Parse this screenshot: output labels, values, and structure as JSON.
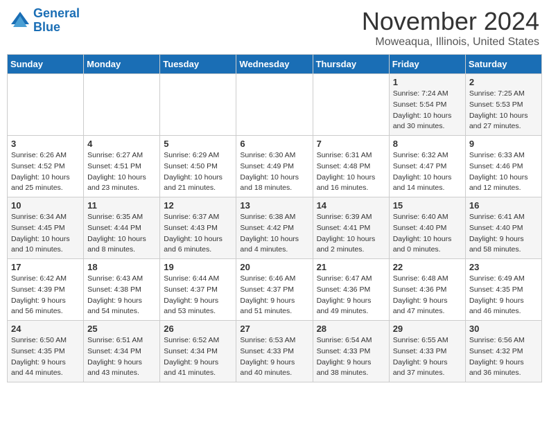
{
  "header": {
    "logo_line1": "General",
    "logo_line2": "Blue",
    "month": "November 2024",
    "location": "Moweaqua, Illinois, United States"
  },
  "days_of_week": [
    "Sunday",
    "Monday",
    "Tuesday",
    "Wednesday",
    "Thursday",
    "Friday",
    "Saturday"
  ],
  "weeks": [
    [
      {
        "day": "",
        "info": ""
      },
      {
        "day": "",
        "info": ""
      },
      {
        "day": "",
        "info": ""
      },
      {
        "day": "",
        "info": ""
      },
      {
        "day": "",
        "info": ""
      },
      {
        "day": "1",
        "info": "Sunrise: 7:24 AM\nSunset: 5:54 PM\nDaylight: 10 hours and 30 minutes."
      },
      {
        "day": "2",
        "info": "Sunrise: 7:25 AM\nSunset: 5:53 PM\nDaylight: 10 hours and 27 minutes."
      }
    ],
    [
      {
        "day": "3",
        "info": "Sunrise: 6:26 AM\nSunset: 4:52 PM\nDaylight: 10 hours and 25 minutes."
      },
      {
        "day": "4",
        "info": "Sunrise: 6:27 AM\nSunset: 4:51 PM\nDaylight: 10 hours and 23 minutes."
      },
      {
        "day": "5",
        "info": "Sunrise: 6:29 AM\nSunset: 4:50 PM\nDaylight: 10 hours and 21 minutes."
      },
      {
        "day": "6",
        "info": "Sunrise: 6:30 AM\nSunset: 4:49 PM\nDaylight: 10 hours and 18 minutes."
      },
      {
        "day": "7",
        "info": "Sunrise: 6:31 AM\nSunset: 4:48 PM\nDaylight: 10 hours and 16 minutes."
      },
      {
        "day": "8",
        "info": "Sunrise: 6:32 AM\nSunset: 4:47 PM\nDaylight: 10 hours and 14 minutes."
      },
      {
        "day": "9",
        "info": "Sunrise: 6:33 AM\nSunset: 4:46 PM\nDaylight: 10 hours and 12 minutes."
      }
    ],
    [
      {
        "day": "10",
        "info": "Sunrise: 6:34 AM\nSunset: 4:45 PM\nDaylight: 10 hours and 10 minutes."
      },
      {
        "day": "11",
        "info": "Sunrise: 6:35 AM\nSunset: 4:44 PM\nDaylight: 10 hours and 8 minutes."
      },
      {
        "day": "12",
        "info": "Sunrise: 6:37 AM\nSunset: 4:43 PM\nDaylight: 10 hours and 6 minutes."
      },
      {
        "day": "13",
        "info": "Sunrise: 6:38 AM\nSunset: 4:42 PM\nDaylight: 10 hours and 4 minutes."
      },
      {
        "day": "14",
        "info": "Sunrise: 6:39 AM\nSunset: 4:41 PM\nDaylight: 10 hours and 2 minutes."
      },
      {
        "day": "15",
        "info": "Sunrise: 6:40 AM\nSunset: 4:40 PM\nDaylight: 10 hours and 0 minutes."
      },
      {
        "day": "16",
        "info": "Sunrise: 6:41 AM\nSunset: 4:40 PM\nDaylight: 9 hours and 58 minutes."
      }
    ],
    [
      {
        "day": "17",
        "info": "Sunrise: 6:42 AM\nSunset: 4:39 PM\nDaylight: 9 hours and 56 minutes."
      },
      {
        "day": "18",
        "info": "Sunrise: 6:43 AM\nSunset: 4:38 PM\nDaylight: 9 hours and 54 minutes."
      },
      {
        "day": "19",
        "info": "Sunrise: 6:44 AM\nSunset: 4:37 PM\nDaylight: 9 hours and 53 minutes."
      },
      {
        "day": "20",
        "info": "Sunrise: 6:46 AM\nSunset: 4:37 PM\nDaylight: 9 hours and 51 minutes."
      },
      {
        "day": "21",
        "info": "Sunrise: 6:47 AM\nSunset: 4:36 PM\nDaylight: 9 hours and 49 minutes."
      },
      {
        "day": "22",
        "info": "Sunrise: 6:48 AM\nSunset: 4:36 PM\nDaylight: 9 hours and 47 minutes."
      },
      {
        "day": "23",
        "info": "Sunrise: 6:49 AM\nSunset: 4:35 PM\nDaylight: 9 hours and 46 minutes."
      }
    ],
    [
      {
        "day": "24",
        "info": "Sunrise: 6:50 AM\nSunset: 4:35 PM\nDaylight: 9 hours and 44 minutes."
      },
      {
        "day": "25",
        "info": "Sunrise: 6:51 AM\nSunset: 4:34 PM\nDaylight: 9 hours and 43 minutes."
      },
      {
        "day": "26",
        "info": "Sunrise: 6:52 AM\nSunset: 4:34 PM\nDaylight: 9 hours and 41 minutes."
      },
      {
        "day": "27",
        "info": "Sunrise: 6:53 AM\nSunset: 4:33 PM\nDaylight: 9 hours and 40 minutes."
      },
      {
        "day": "28",
        "info": "Sunrise: 6:54 AM\nSunset: 4:33 PM\nDaylight: 9 hours and 38 minutes."
      },
      {
        "day": "29",
        "info": "Sunrise: 6:55 AM\nSunset: 4:33 PM\nDaylight: 9 hours and 37 minutes."
      },
      {
        "day": "30",
        "info": "Sunrise: 6:56 AM\nSunset: 4:32 PM\nDaylight: 9 hours and 36 minutes."
      }
    ]
  ]
}
